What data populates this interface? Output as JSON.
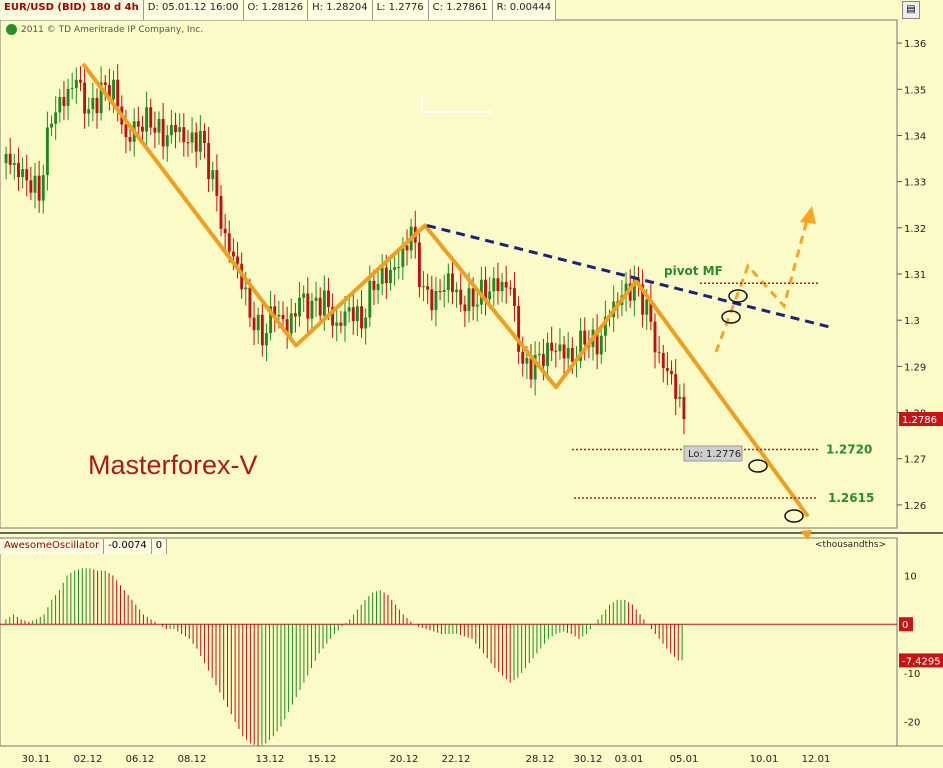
{
  "header": {
    "symbol": "EUR/USD (BID) 180 d 4h",
    "date": "D: 05.01.12 16:00",
    "open": "O: 1.28126",
    "high": "H: 1.28204",
    "low": "L: 1.2776",
    "close": "C: 1.27861",
    "range": "R: 0.00444",
    "copyright": "2011 © TD Ameritrade IP Company, Inc."
  },
  "chart_data": [
    {
      "type": "candlestick",
      "ylim": [
        1.255,
        1.365
      ],
      "yticks": [
        1.36,
        1.35,
        1.34,
        1.33,
        1.32,
        1.31,
        1.3,
        1.29,
        1.28,
        1.27,
        1.26
      ],
      "xticks": [
        "30.11",
        "02.12",
        "06.12",
        "08.12",
        "13.12",
        "15.12",
        "20.12",
        "22.12",
        "28.12",
        "30.12",
        "03.01",
        "05.01",
        "10.01",
        "12.01"
      ],
      "bars_anchor_close": [
        1.333,
        1.331,
        1.328,
        1.345,
        1.348,
        1.352,
        1.344,
        1.349,
        1.35,
        1.339,
        1.343,
        1.344,
        1.34,
        1.342,
        1.338,
        1.339,
        1.33,
        1.317,
        1.312,
        1.302,
        1.297,
        1.303,
        1.298,
        1.304,
        1.302,
        1.304,
        1.298,
        1.303,
        1.3,
        1.309,
        1.31,
        1.312,
        1.319,
        1.305,
        1.304,
        1.309,
        1.304,
        1.305,
        1.307,
        1.308,
        1.307,
        1.289,
        1.29,
        1.293,
        1.294,
        1.292,
        1.297,
        1.295,
        1.302,
        1.305,
        1.307,
        1.302,
        1.291,
        1.288,
        1.2786
      ],
      "current_price": "1.2786",
      "low_label": "Lo: 1.2776",
      "levels": [
        {
          "label": "pivot MF",
          "value": 1.308
        },
        {
          "label": "1.2720",
          "value": 1.272
        },
        {
          "label": "1.2615",
          "value": 1.2615
        }
      ],
      "annotations": [
        "Masterforex-V"
      ]
    },
    {
      "type": "bar",
      "title": "AwesomeOscillator",
      "readout": "-0.0074",
      "param": "0",
      "ylim": [
        -25,
        14
      ],
      "yticks": [
        10,
        0,
        -10,
        -20
      ],
      "zero_label": "0",
      "current_value": "-7.4295",
      "scale_label": "<thousandths>",
      "values": [
        1,
        2,
        1,
        0.5,
        1,
        2,
        5,
        7,
        10,
        11,
        11.5,
        11.5,
        11,
        11,
        10,
        8,
        6,
        4,
        2,
        1,
        0,
        -1,
        -1,
        -2,
        -3,
        -5,
        -8,
        -11,
        -14,
        -17,
        -20,
        -23,
        -24.5,
        -25,
        -24.5,
        -23,
        -21,
        -18,
        -15,
        -12,
        -9,
        -6,
        -4,
        -2,
        -0.5,
        1,
        3,
        5,
        6.5,
        7,
        6,
        4,
        2,
        0.5,
        -0.5,
        -1,
        -1.5,
        -2,
        -2,
        -2,
        -2.5,
        -3,
        -5,
        -7,
        -9,
        -10.5,
        -12,
        -11,
        -9,
        -7,
        -5,
        -3,
        -2,
        -1.5,
        -2,
        -3,
        -2,
        0,
        2,
        4,
        5,
        5,
        4,
        2,
        0,
        -2,
        -4,
        -6,
        -7.4
      ]
    }
  ]
}
